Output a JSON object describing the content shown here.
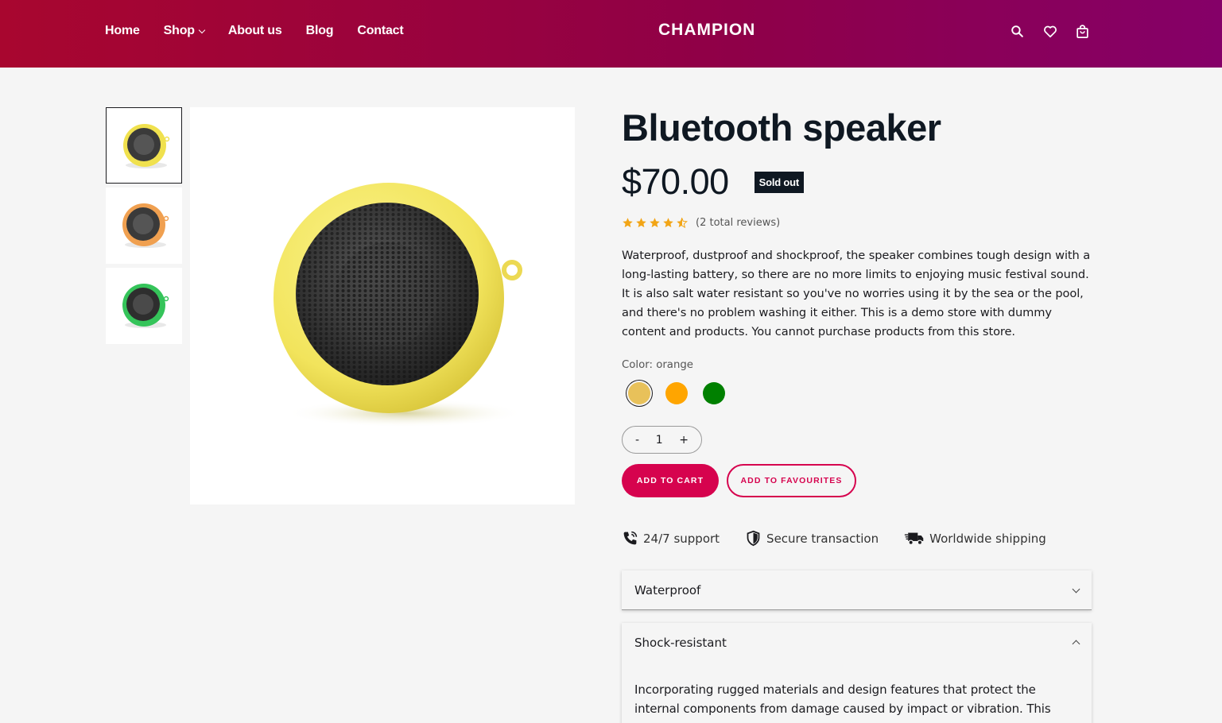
{
  "header": {
    "nav": [
      {
        "label": "Home"
      },
      {
        "label": "Shop",
        "has_dropdown": true
      },
      {
        "label": "About us"
      },
      {
        "label": "Blog"
      },
      {
        "label": "Contact"
      }
    ],
    "logo": "CHAMPION",
    "icons": [
      "search-icon",
      "heart-icon",
      "shopping-bag-icon"
    ],
    "gradient": [
      "#a8062f",
      "#850068"
    ]
  },
  "gallery": {
    "thumbnails": [
      {
        "color": "#f0e14e",
        "active": true
      },
      {
        "color": "#f0a050",
        "active": false
      },
      {
        "color": "#35c45a",
        "active": false
      }
    ],
    "main_image_color": "#f4ea6a"
  },
  "product": {
    "title": "Bluetooth speaker",
    "price": "$70.00",
    "badge": "Sold out",
    "rating": 4.5,
    "reviews": "(2 total reviews)",
    "description": "Waterproof, dustproof and shockproof, the speaker combines tough design with a long-lasting battery, so there are no more limits to enjoying music festival sound. It is also salt water resistant so you've no worries using it by the sea or the pool, and there's no problem washing it either. This is a demo store with dummy content and products. You cannot purchase products from this store.",
    "color_label": "Color: orange",
    "swatches": [
      {
        "color": "#e8c15a",
        "selected": true
      },
      {
        "color": "#ffa500",
        "selected": false
      },
      {
        "color": "#008000",
        "selected": false
      }
    ],
    "quantity": {
      "minus": "-",
      "value": "1",
      "plus": "+"
    },
    "add_to_cart": "ADD TO CART",
    "add_to_favourites": "ADD TO FAVOURITES",
    "accent": "#d6034e"
  },
  "features": [
    {
      "icon": "phone-support-icon",
      "label": "24/7 support"
    },
    {
      "icon": "shield-icon",
      "label": "Secure transaction"
    },
    {
      "icon": "truck-icon",
      "label": "Worldwide shipping"
    }
  ],
  "accordion": [
    {
      "title": "Waterproof",
      "expanded": false
    },
    {
      "title": "Shock-resistant",
      "expanded": true,
      "body": "Incorporating rugged materials and design features that protect the internal components from damage caused by impact or vibration. This"
    }
  ]
}
